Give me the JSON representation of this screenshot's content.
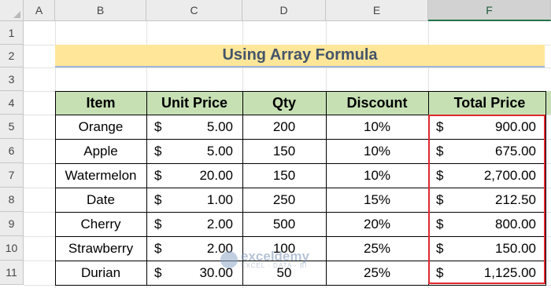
{
  "columns": [
    "A",
    "B",
    "C",
    "D",
    "E",
    "F"
  ],
  "rows": [
    "1",
    "2",
    "3",
    "4",
    "5",
    "6",
    "7",
    "8",
    "9",
    "10",
    "11"
  ],
  "title": "Using Array Formula",
  "headers": {
    "item": "Item",
    "unit_price": "Unit Price",
    "qty": "Qty",
    "discount": "Discount",
    "total_price": "Total Price"
  },
  "currency_symbol": "$",
  "table": [
    {
      "item": "Orange",
      "unit_price": "5.00",
      "qty": "200",
      "discount": "10%",
      "total": "900.00"
    },
    {
      "item": "Apple",
      "unit_price": "5.00",
      "qty": "150",
      "discount": "10%",
      "total": "675.00"
    },
    {
      "item": "Watermelon",
      "unit_price": "20.00",
      "qty": "150",
      "discount": "10%",
      "total": "2,700.00"
    },
    {
      "item": "Date",
      "unit_price": "1.00",
      "qty": "250",
      "discount": "15%",
      "total": "212.50"
    },
    {
      "item": "Cherry",
      "unit_price": "2.00",
      "qty": "500",
      "discount": "20%",
      "total": "800.00"
    },
    {
      "item": "Strawberry",
      "unit_price": "2.00",
      "qty": "100",
      "discount": "25%",
      "total": "150.00"
    },
    {
      "item": "Durian",
      "unit_price": "30.00",
      "qty": "50",
      "discount": "25%",
      "total": "1,125.00"
    }
  ],
  "selected_column": "F",
  "colors": {
    "title_fill": "#ffe699",
    "header_fill": "#c6e0b4",
    "highlight_border": "#e0282e",
    "title_text": "#44546a"
  },
  "watermark": {
    "main": "exceldemy",
    "sub": "EXCEL · DATA · BI"
  }
}
